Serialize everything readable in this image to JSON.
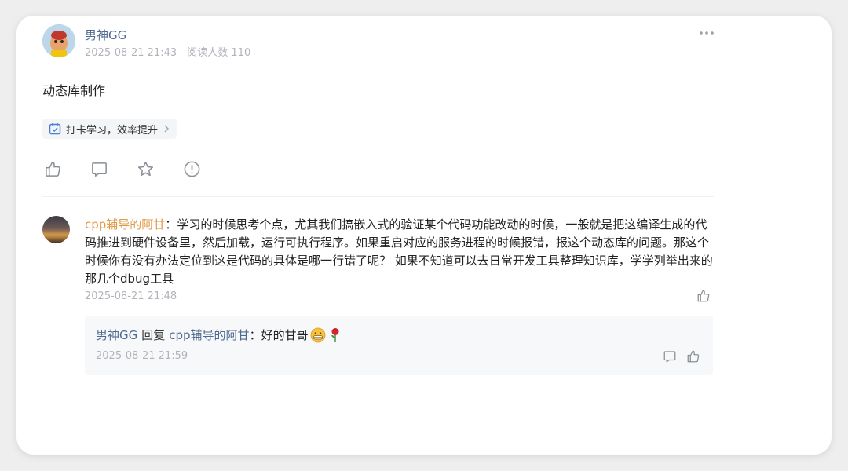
{
  "post": {
    "author": "男神GG",
    "date": "2025-08-21 21:43",
    "read_count": "阅读人数 110",
    "title": "动态库制作",
    "tag": "打卡学习，效率提升"
  },
  "comment": {
    "author": "cpp辅导的阿甘",
    "separator": "：",
    "text": "学习的时候思考个点，尤其我们搞嵌入式的验证某个代码功能改动的时候，一般就是把这编译生成的代码推进到硬件设备里，然后加载，运行可执行程序。如果重启对应的服务进程的时候报错，报这个动态库的问题。那这个时候你有没有办法定位到这是代码的具体是哪一行错了呢？  如果不知道可以去日常开发工具整理知识库，学学列举出来的那几个dbug工具",
    "time": "2025-08-21 21:48"
  },
  "reply": {
    "from": "男神GG",
    "verb": "回复",
    "to": "cpp辅导的阿甘",
    "separator": "：",
    "text": "好的甘哥",
    "time": "2025-08-21 21:59",
    "emojis": [
      "grinning-face-emoji",
      "rose-emoji"
    ]
  },
  "colors": {
    "link_blue": "#4f6a8f",
    "commenter_orange": "#e09a45",
    "meta_gray": "#b0b4ba",
    "icon_gray": "#8a8f96"
  },
  "icons": [
    "more-icon",
    "checkin-icon",
    "chevron-right-icon",
    "like-icon",
    "comment-icon",
    "star-icon",
    "report-icon"
  ]
}
